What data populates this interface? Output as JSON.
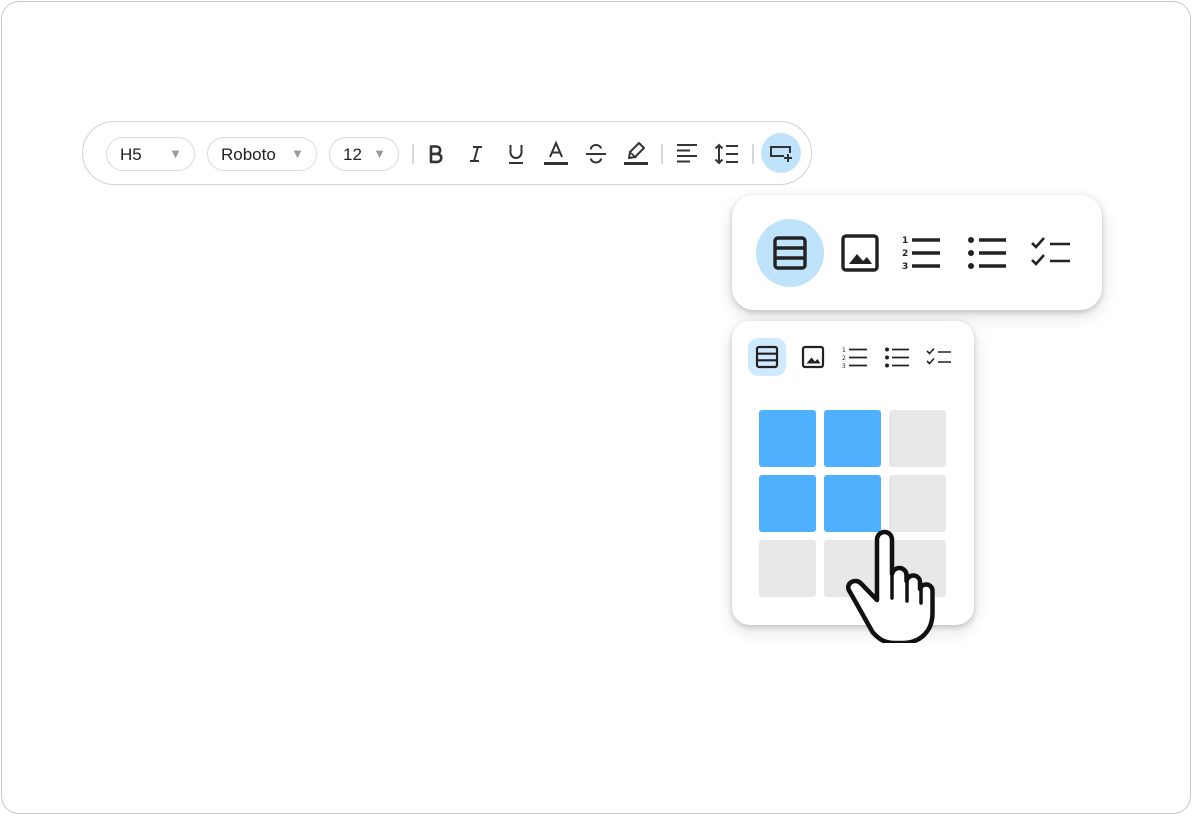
{
  "toolbar": {
    "heading_select": {
      "value": "H5",
      "arrow": "▼"
    },
    "font_select": {
      "value": "Roboto",
      "arrow": "▼"
    },
    "size_select": {
      "value": "12",
      "arrow": "▼"
    },
    "buttons": [
      "bold-icon",
      "italic-icon",
      "underline-icon",
      "text-color-icon",
      "strikethrough-icon",
      "highlighter-icon",
      "align-left-icon",
      "line-spacing-icon",
      "insert-icon"
    ],
    "active_button": "insert-icon"
  },
  "insert_menu_large": {
    "items": [
      "table-icon",
      "image-icon",
      "numbered-list-icon",
      "bulleted-list-icon",
      "checklist-icon"
    ],
    "selected": "table-icon"
  },
  "insert_menu_small": {
    "items": [
      "table-icon",
      "image-icon",
      "numbered-list-icon",
      "bulleted-list-icon",
      "checklist-icon"
    ],
    "selected": "table-icon",
    "table_picker": {
      "rows": 3,
      "cols": 3,
      "selected_rows": 2,
      "selected_cols": 2
    }
  },
  "colors": {
    "accent_light": "#bfe3fb",
    "picker_selected": "#4fb0fd",
    "picker_empty": "#e8e8e8"
  }
}
